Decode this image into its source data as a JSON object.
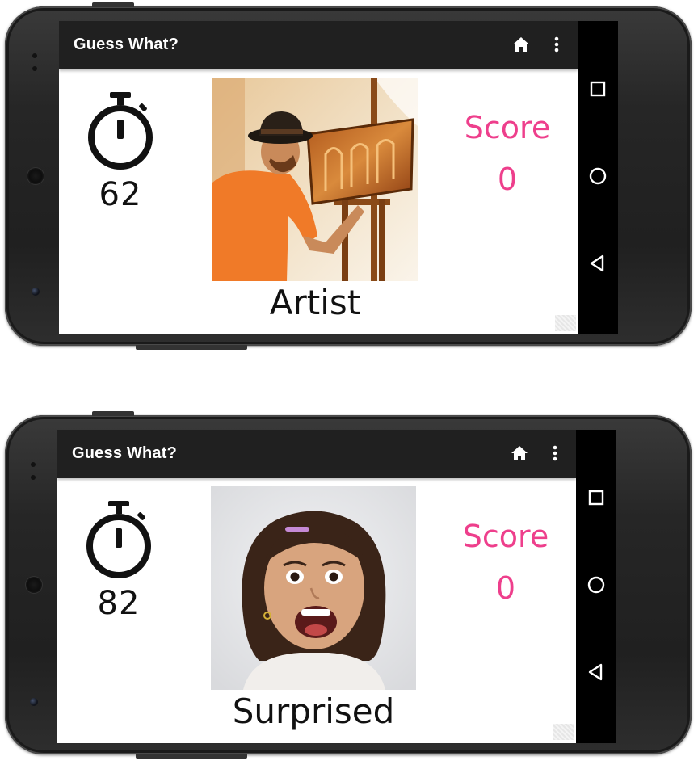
{
  "screens": [
    {
      "app_title": "Guess What?",
      "icons": {
        "home": "home-icon",
        "more": "more-vert-icon",
        "timer": "stopwatch-icon"
      },
      "timer_value": "62",
      "photo_subject": "artist-painting",
      "word": "Artist",
      "score_label": "Score",
      "score_value": "0"
    },
    {
      "app_title": "Guess What?",
      "icons": {
        "home": "home-icon",
        "more": "more-vert-icon",
        "timer": "stopwatch-icon"
      },
      "timer_value": "82",
      "photo_subject": "surprised-child",
      "word": "Surprised",
      "score_label": "Score",
      "score_value": "0"
    }
  ],
  "system_nav": {
    "recents": "square-icon",
    "home": "circle-icon",
    "back": "triangle-back-icon"
  },
  "colors": {
    "appbar": "#202020",
    "score": "#ee3f8c",
    "text": "#111111",
    "navbar": "#000000"
  }
}
